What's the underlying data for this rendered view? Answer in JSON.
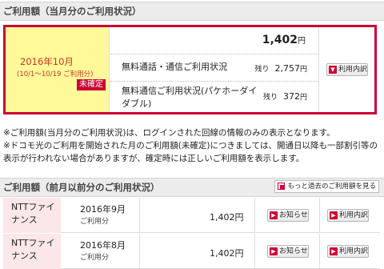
{
  "current": {
    "header": "ご利用額（当月分のご利用状況）",
    "month": "2016年10月",
    "range": "(10/1～10/19 ご利用分)",
    "status_badge": "未確定",
    "total_amount": "1,402",
    "yen": "円",
    "rows": [
      {
        "label": "無料通話・通信ご利用状況",
        "remaining_label": "残り",
        "remaining_value": "2,757",
        "unit": "円"
      },
      {
        "label": "無料通信ご利用状況(パケホーダイダブル)",
        "remaining_label": "残り",
        "remaining_value": "372",
        "unit": "円"
      }
    ],
    "detail_button": "利用内訳"
  },
  "notes": [
    "※ご利用額(当月分のご利用状況)は、ログインされた回線の情報のみの表示となります。",
    "※ドコモ光のご利用を開始された月のご利用額(未確定)につきましては、開通日以降も一部割引等の表示が行われない場合がありますが、確定時には正しいご利用額を表示します。"
  ],
  "history": {
    "header": "ご利用額（前月以前分のご利用状況）",
    "past_button": "もっと過去のご利用額を見る",
    "rows": [
      {
        "name": "NTTファイナンス",
        "month": "2016年9月",
        "sub": "ご利用分",
        "amount": "1,402円",
        "notice_button": "お知らせ",
        "detail_button": "利用内訳"
      },
      {
        "name": "NTTファイナンス",
        "month": "2016年8月",
        "sub": "ご利用分",
        "amount": "1,402円",
        "notice_button": "お知らせ",
        "detail_button": "利用内訳"
      }
    ]
  },
  "colors": {
    "accent": "#cc0033",
    "highlight": "#fff99a",
    "row_pink": "#fbe7ea",
    "header_bg": "#ececec"
  }
}
